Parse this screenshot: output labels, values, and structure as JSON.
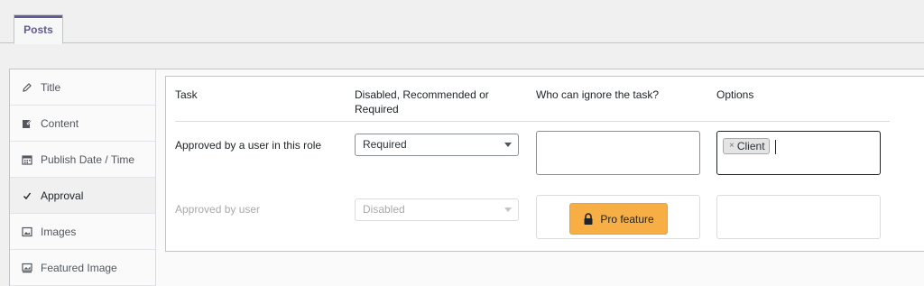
{
  "tabs": [
    {
      "label": "Posts",
      "active": true
    }
  ],
  "sidebar": {
    "items": [
      {
        "label": "Title",
        "icon": "pencil-icon",
        "active": false
      },
      {
        "label": "Content",
        "icon": "edit-icon",
        "active": false
      },
      {
        "label": "Publish Date / Time",
        "icon": "calendar-icon",
        "active": false
      },
      {
        "label": "Approval",
        "icon": "check-icon",
        "active": true
      },
      {
        "label": "Images",
        "icon": "image-icon",
        "active": false
      },
      {
        "label": "Featured Image",
        "icon": "featured-image-icon",
        "active": false
      }
    ]
  },
  "table": {
    "headers": [
      "Task",
      "Disabled, Recommended or Required",
      "Who can ignore the task?",
      "Options"
    ],
    "rows": [
      {
        "task": "Approved by a user in this role",
        "status": "Required",
        "who_can_ignore": "",
        "options_tags": [
          "Client"
        ],
        "disabled": false
      },
      {
        "task": "Approved by user",
        "status": "Disabled",
        "pro_feature_label": "Pro feature",
        "options_value": "",
        "disabled": true
      }
    ]
  },
  "colors": {
    "accent": "#655997",
    "pro_button": "#f6ae45",
    "disabled_text": "#a7aaad"
  }
}
